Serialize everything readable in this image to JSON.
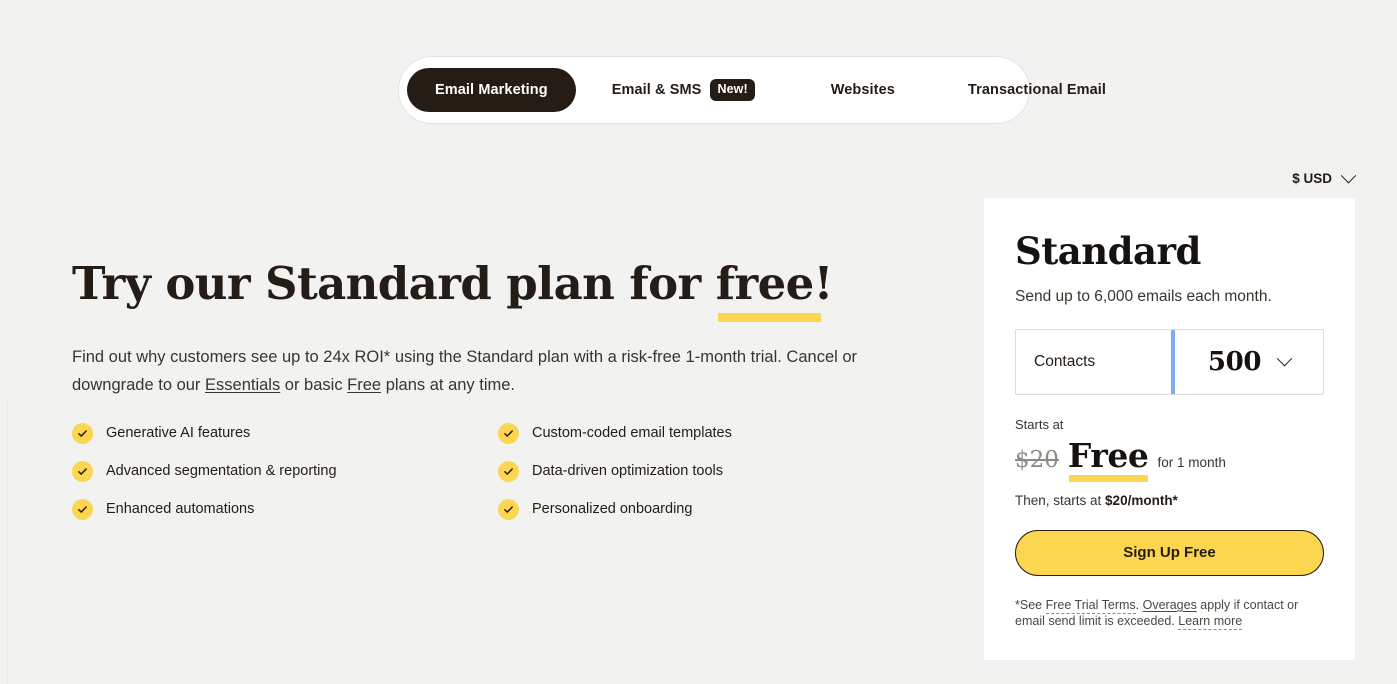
{
  "theme": {
    "page_bg": "#f2f2f0",
    "card_bg": "#ffffff",
    "accent_yellow": "#fcd650",
    "ink": "#241c15",
    "divider_blue": "#7fadf5"
  },
  "tabs": [
    {
      "label": "Email Marketing",
      "active": true,
      "badge": ""
    },
    {
      "label": "Email & SMS",
      "active": false,
      "badge": "New!"
    },
    {
      "label": "Websites",
      "active": false,
      "badge": ""
    },
    {
      "label": "Transactional Email",
      "active": false,
      "badge": ""
    }
  ],
  "currency": {
    "label": "$ USD",
    "icon": "chevron-down-icon"
  },
  "hero": {
    "headline_pre": "Try our Standard plan for ",
    "headline_mark": "free!",
    "subcopy_1": "Find out why customers see up to 24x ROI* using the Standard plan with a risk-free 1-month trial. Cancel or downgrade to our ",
    "link_essentials": "Essentials",
    "subcopy_2": " or basic ",
    "link_free": "Free",
    "subcopy_3": " plans at any time."
  },
  "features": [
    "Generative AI features",
    "Custom-coded email templates",
    "Advanced segmentation & reporting",
    "Data-driven optimization tools",
    "Enhanced automations",
    "Personalized onboarding"
  ],
  "card": {
    "title": "Standard",
    "subtitle": "Send up to 6,000 emails each month.",
    "contacts_label": "Contacts",
    "contacts_value": "500",
    "starts_at_label": "Starts at",
    "old_price": "$20",
    "free_price": "Free",
    "for_duration": "for 1 month",
    "then_prefix": "Then, starts at ",
    "then_price": "$20/month*",
    "cta_label": "Sign Up Free",
    "fine_star": "*See ",
    "fine_terms": "Free Trial Terms",
    "fine_mid1": ". ",
    "fine_overages": "Overages",
    "fine_mid2": " apply if contact or email send limit is exceeded. ",
    "fine_learn": "Learn more"
  }
}
